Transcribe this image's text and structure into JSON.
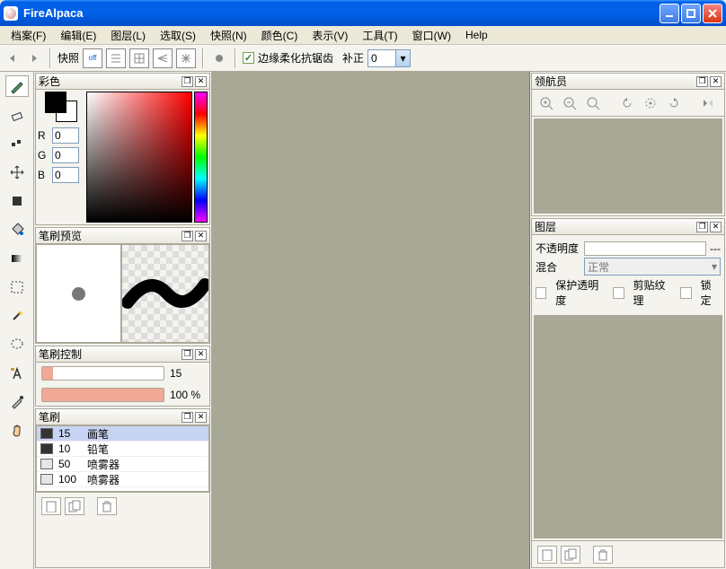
{
  "app": {
    "title": "FireAlpaca"
  },
  "menu": {
    "file": "档案(F)",
    "edit": "编辑(E)",
    "layer": "图层(L)",
    "select": "选取(S)",
    "snap": "快照(N)",
    "color": "颜色(C)",
    "display": "表示(V)",
    "tool": "工具(T)",
    "window": "窗口(W)",
    "help": "Help"
  },
  "toolbar": {
    "snap_label": "快照",
    "aa_label": "边缘柔化抗锯齿",
    "correction_label": "补正",
    "correction_value": "0"
  },
  "panels": {
    "color": {
      "title": "彩色",
      "r_label": "R",
      "g_label": "G",
      "b_label": "B",
      "r": "0",
      "g": "0",
      "b": "0"
    },
    "brush_preview": {
      "title": "笔刷预览"
    },
    "brush_ctrl": {
      "title": "笔刷控制",
      "size_value": "15",
      "opacity_value": "100 %",
      "size_fill": 9,
      "opacity_fill": 100
    },
    "brushes": {
      "title": "笔刷",
      "items": [
        {
          "size": "15",
          "name": "画笔",
          "selected": true,
          "light": false
        },
        {
          "size": "10",
          "name": "铅笔",
          "selected": false,
          "light": false
        },
        {
          "size": "50",
          "name": "喷雾器",
          "selected": false,
          "light": true
        },
        {
          "size": "100",
          "name": "喷雾器",
          "selected": false,
          "light": true
        }
      ]
    },
    "navigator": {
      "title": "领航员"
    },
    "layers": {
      "title": "图层",
      "opacity_label": "不透明度",
      "opacity_suffix": "---",
      "blend_label": "混合",
      "blend_value": "正常",
      "protect_alpha": "保护透明度",
      "clipping": "剪贴纹理",
      "lock": "锁定"
    }
  }
}
